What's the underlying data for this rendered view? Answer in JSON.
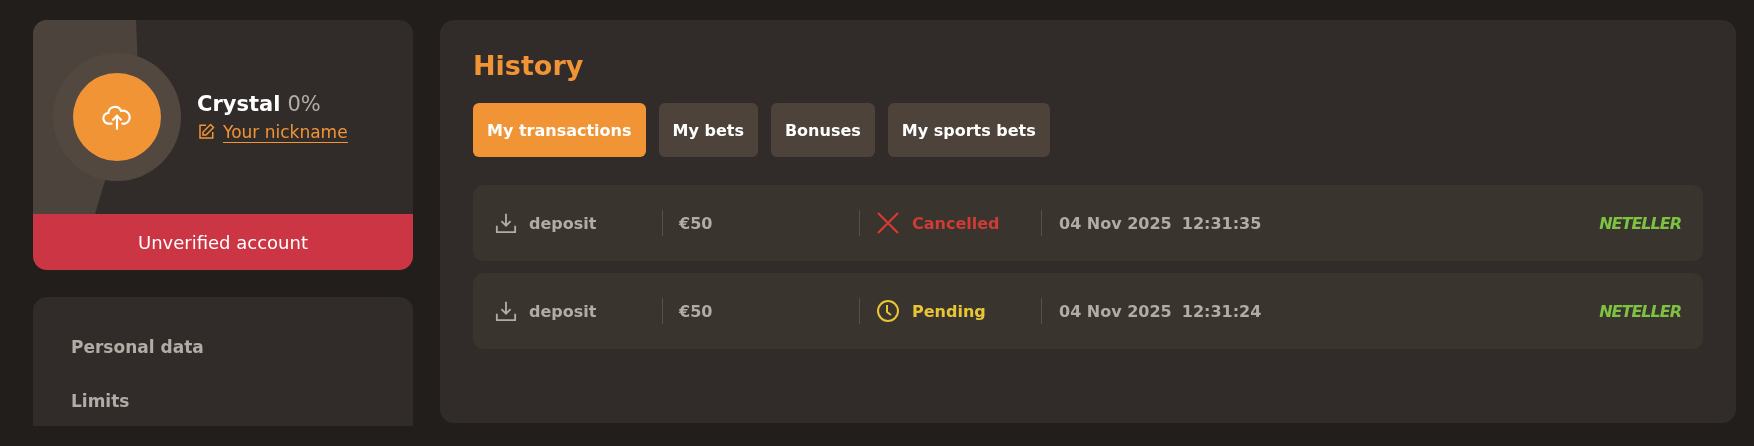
{
  "profile": {
    "name": "Crystal",
    "progress": "0%",
    "nickname_link": "Your nickname",
    "banner": "Unverified account"
  },
  "menu": {
    "items": [
      {
        "label": "Personal data"
      },
      {
        "label": "Limits"
      }
    ]
  },
  "history": {
    "title": "History",
    "tabs": [
      {
        "label": "My transactions",
        "selected": true
      },
      {
        "label": "My bets",
        "selected": false
      },
      {
        "label": "Bonuses",
        "selected": false
      },
      {
        "label": "My sports bets",
        "selected": false
      }
    ],
    "rows": [
      {
        "type": "deposit",
        "amount": "€50",
        "status": {
          "kind": "cancelled",
          "label": "Cancelled"
        },
        "date": "04 Nov 2025",
        "time": "12:31:35",
        "method": "NETELLER"
      },
      {
        "type": "deposit",
        "amount": "€50",
        "status": {
          "kind": "pending",
          "label": "Pending"
        },
        "date": "04 Nov 2025",
        "time": "12:31:24",
        "method": "NETELLER"
      }
    ]
  }
}
